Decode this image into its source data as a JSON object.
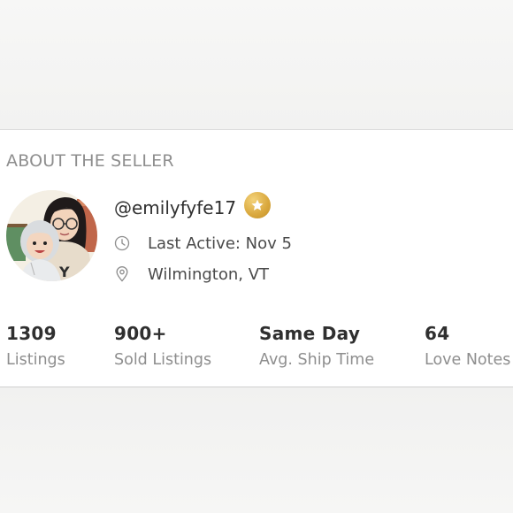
{
  "section_title": "ABOUT THE SELLER",
  "seller": {
    "username": "@emilyfyfe17",
    "last_active": "Last Active: Nov 5",
    "location": "Wilmington, VT",
    "badge_icon": "star-icon"
  },
  "stats": [
    {
      "value": "1309",
      "label": "Listings"
    },
    {
      "value": "900+",
      "label": "Sold Listings"
    },
    {
      "value": "Same Day",
      "label": "Avg. Ship Time"
    },
    {
      "value": "64",
      "label": "Love Notes"
    }
  ],
  "colors": {
    "badge_gold": "#d9a73c",
    "label_gray": "#8e8e8e",
    "text_dark": "#2f2f2f"
  }
}
